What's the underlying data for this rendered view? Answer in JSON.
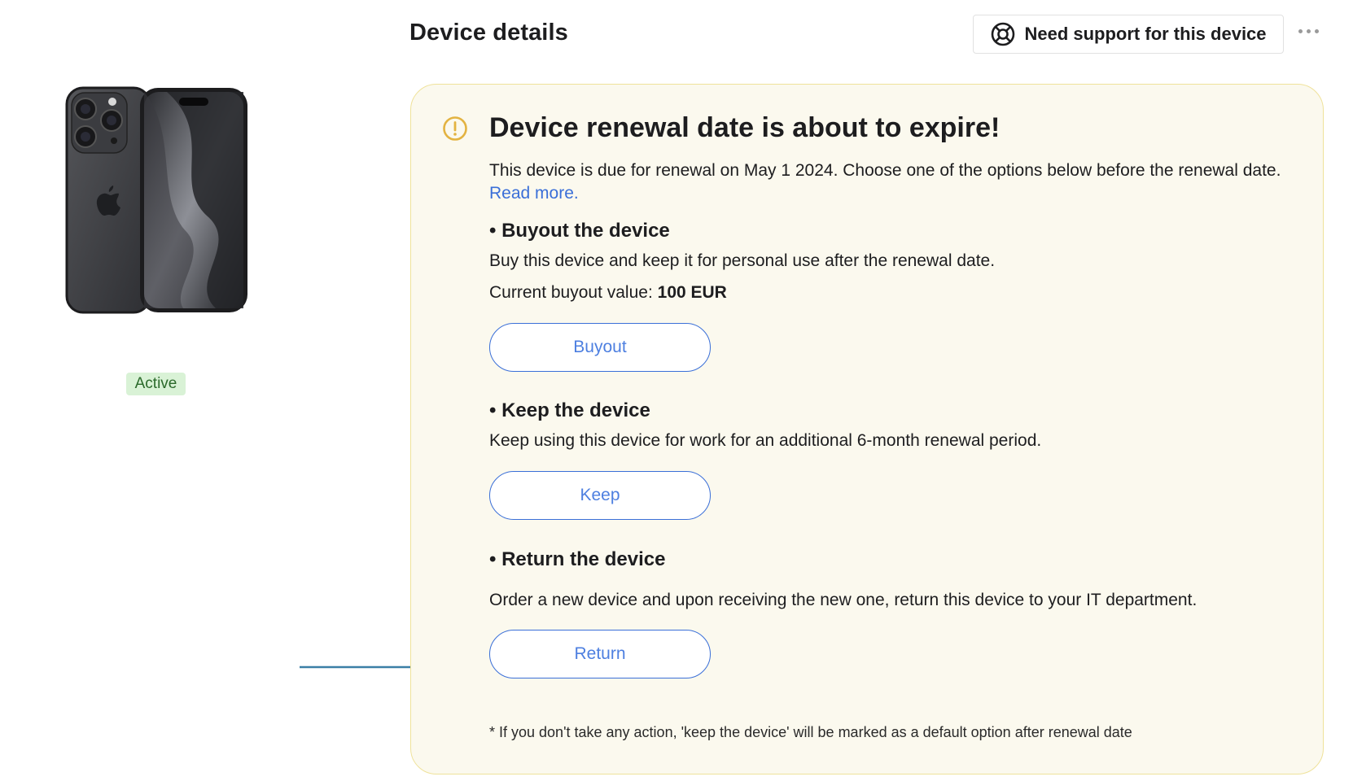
{
  "header": {
    "title": "Device details",
    "support_button_label": "Need support for this device"
  },
  "device": {
    "status": "Active",
    "status_color": "#d9f2d6"
  },
  "notice": {
    "title": "Device renewal date is about to expire!",
    "description": "This device is due for renewal on May 1 2024. Choose one of the options below before the renewal date.",
    "read_more": "Read more.",
    "background_color": "#fbf9ee",
    "border_color": "#efe29a",
    "icon": "warning-icon"
  },
  "options": {
    "buyout": {
      "title": "• Buyout the device",
      "text": "Buy this device and keep it for personal use after the renewal date.",
      "value_label": "Current buyout value:",
      "value": "100 EUR",
      "button_label": "Buyout"
    },
    "keep": {
      "title": "• Keep the device",
      "text": "Keep using this device for work for an additional 6-month renewal period.",
      "button_label": "Keep"
    },
    "return": {
      "title": "• Return the device",
      "text": "Order a new device and upon receiving the new one, return this device to your IT department.",
      "button_label": "Return"
    }
  },
  "footnote": "* If you don't take any action, 'keep the device' will be marked as a default option after renewal date",
  "colors": {
    "accent": "#3a6fd8",
    "arrow": "#3b7fa6"
  }
}
